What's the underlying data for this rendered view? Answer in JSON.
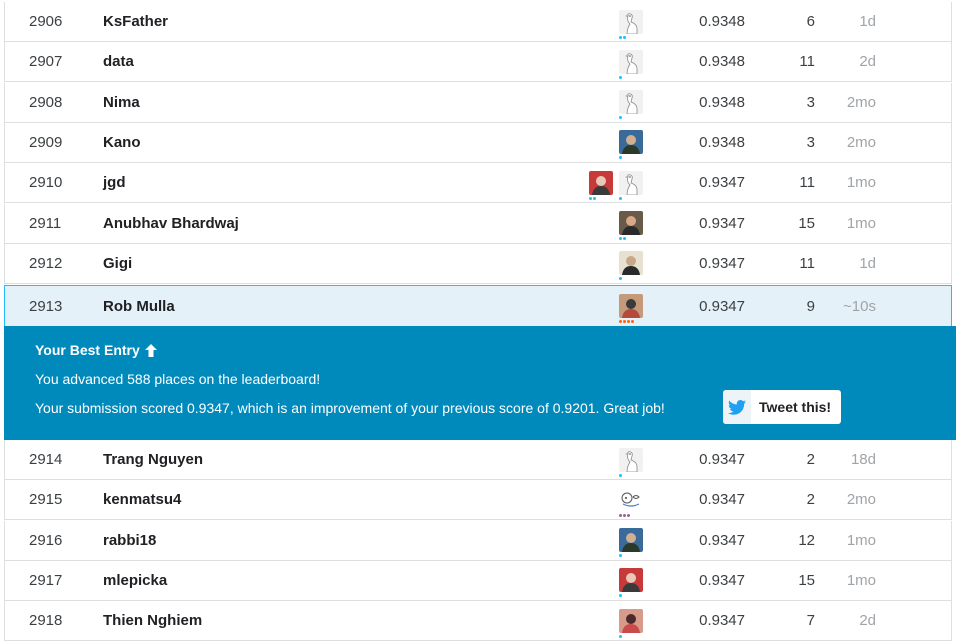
{
  "rows_top": [
    {
      "rank": "2906",
      "team": "KsFather",
      "score": "0.9348",
      "entries": "6",
      "last": "1d",
      "avatars": [
        {
          "icon": "goose-default-avatar-icon",
          "tier": [
            "#20beff",
            "#20beff"
          ]
        }
      ]
    },
    {
      "rank": "2907",
      "team": "data",
      "score": "0.9348",
      "entries": "11",
      "last": "2d",
      "avatars": [
        {
          "icon": "goose-default-avatar-icon",
          "tier": [
            "#20beff"
          ]
        }
      ]
    },
    {
      "rank": "2908",
      "team": "Nima",
      "score": "0.9348",
      "entries": "3",
      "last": "2mo",
      "avatars": [
        {
          "icon": "goose-default-avatar-icon",
          "tier": [
            "#20beff"
          ]
        }
      ]
    },
    {
      "rank": "2909",
      "team": "Kano",
      "score": "0.9348",
      "entries": "3",
      "last": "2mo",
      "avatars": [
        {
          "icon": "user-photo-avatar-icon",
          "tier": [
            "#20beff"
          ]
        }
      ]
    },
    {
      "rank": "2910",
      "team": "jgd",
      "score": "0.9347",
      "entries": "11",
      "last": "1mo",
      "avatars": [
        {
          "icon": "user-photo-avatar-icon",
          "tier": [
            "#20beff",
            "#20beff"
          ]
        },
        {
          "icon": "goose-default-avatar-icon",
          "tier": [
            "#20beff"
          ]
        }
      ]
    },
    {
      "rank": "2911",
      "team": "Anubhav Bhardwaj",
      "score": "0.9347",
      "entries": "15",
      "last": "1mo",
      "avatars": [
        {
          "icon": "user-photo-avatar-icon",
          "tier": [
            "#20beff",
            "#20beff"
          ]
        }
      ]
    },
    {
      "rank": "2912",
      "team": "Gigi",
      "score": "0.9347",
      "entries": "11",
      "last": "1d",
      "avatars": [
        {
          "icon": "user-photo-avatar-icon",
          "tier": [
            "#20beff"
          ]
        }
      ]
    }
  ],
  "highlight_row": {
    "rank": "2913",
    "team": "Rob Mulla",
    "score": "0.9347",
    "entries": "9",
    "last": "~10s",
    "avatars": [
      {
        "icon": "user-photo-avatar-icon",
        "tier": [
          "#f96517",
          "#f96517",
          "#f96517",
          "#f96517"
        ]
      }
    ]
  },
  "banner": {
    "title": "Your Best Entry",
    "line1": "You advanced 588 places on the leaderboard!",
    "line2": "Your submission scored 0.9347, which is an improvement of your previous score of 0.9201. Great job!",
    "tweet_label": "Tweet this!",
    "background": "#008abc"
  },
  "rows_bottom": [
    {
      "rank": "2914",
      "team": "Trang Nguyen",
      "score": "0.9347",
      "entries": "2",
      "last": "18d",
      "avatars": [
        {
          "icon": "goose-default-avatar-icon",
          "tier": [
            "#20beff"
          ]
        }
      ]
    },
    {
      "rank": "2915",
      "team": "kenmatsu4",
      "score": "0.9347",
      "entries": "2",
      "last": "2mo",
      "avatars": [
        {
          "icon": "cartoon-avatar-icon",
          "tier": [
            "#976591",
            "#976591",
            "#976591"
          ]
        }
      ]
    },
    {
      "rank": "2916",
      "team": "rabbi18",
      "score": "0.9347",
      "entries": "12",
      "last": "1mo",
      "avatars": [
        {
          "icon": "user-photo-avatar-icon",
          "tier": [
            "#20beff"
          ]
        }
      ]
    },
    {
      "rank": "2917",
      "team": "mlepicka",
      "score": "0.9347",
      "entries": "15",
      "last": "1mo",
      "avatars": [
        {
          "icon": "user-photo-avatar-icon",
          "tier": [
            "#20beff"
          ]
        }
      ]
    },
    {
      "rank": "2918",
      "team": "Thien Nghiem",
      "score": "0.9347",
      "entries": "7",
      "last": "2d",
      "avatars": [
        {
          "icon": "user-photo-avatar-icon",
          "tier": [
            "#20beff"
          ]
        }
      ]
    }
  ]
}
